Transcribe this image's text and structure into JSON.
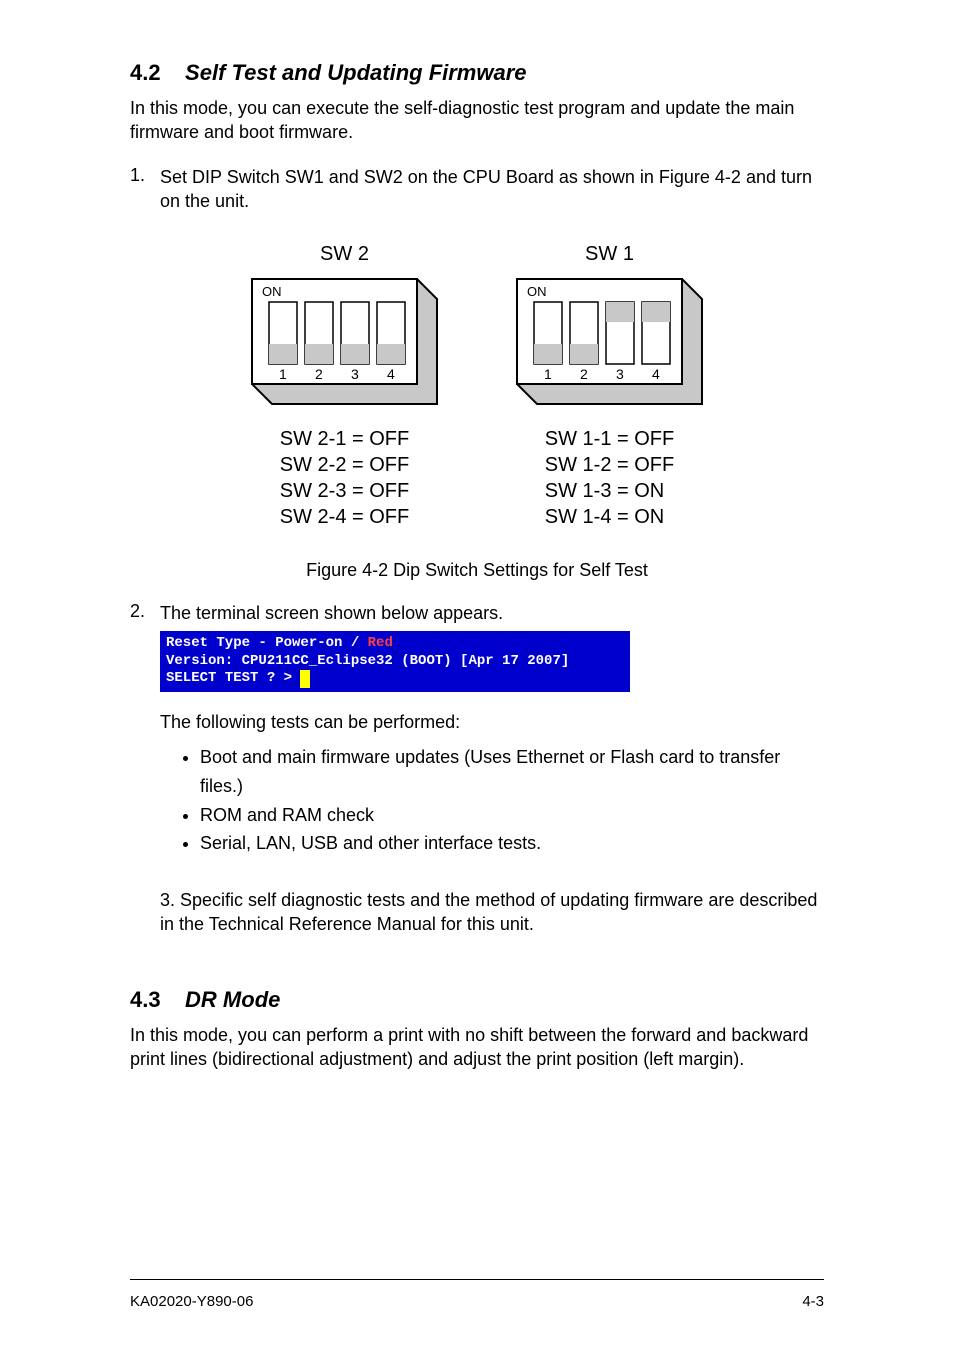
{
  "section": {
    "num": "4.2",
    "title": "Self Test and Updating Firmware"
  },
  "intro": "In this mode, you can execute the self-diagnostic test program and update the main firmware and boot firmware.",
  "steps": {
    "s1": {
      "num": "1.",
      "text": "Set DIP Switch SW1 and SW2 on the CPU Board as shown in Figure 4-2 and turn on the unit."
    },
    "s2": {
      "num": "2.",
      "text": "The terminal screen shown below appears."
    },
    "s3": {
      "num": "3.",
      "text": "Specific self diagnostic tests and the method of updating firmware are described in the Technical Reference Manual for this unit."
    }
  },
  "figure": {
    "caption": "Figure 4-2 Dip Switch Settings for Self Test"
  },
  "dip": {
    "sw2": {
      "title": "SW 2",
      "on_label": "ON",
      "positions": [
        "OFF",
        "OFF",
        "OFF",
        "OFF"
      ],
      "numbers": [
        "1",
        "2",
        "3",
        "4"
      ],
      "lines": [
        "SW 2-1 = OFF",
        "SW 2-2 = OFF",
        "SW 2-3 = OFF",
        "SW 2-4 = OFF"
      ]
    },
    "sw1": {
      "title": "SW 1",
      "on_label": "ON",
      "positions": [
        "OFF",
        "OFF",
        "ON",
        "ON"
      ],
      "numbers": [
        "1",
        "2",
        "3",
        "4"
      ],
      "lines": [
        "SW 1-1 = OFF",
        "SW 1-2 = OFF",
        "SW 1-3 = ON",
        "SW 1-4 = ON"
      ]
    }
  },
  "terminal": {
    "line1a": "Reset Type - Power-on / ",
    "line1b": "Red",
    "line2": "Version: CPU211CC_Eclipse32 (BOOT) [Apr 17 2007]",
    "line3": "SELECT TEST ? > "
  },
  "tests": {
    "label": "The following tests can be performed:",
    "items": [
      "Boot and main firmware updates (Uses Ethernet or Flash card to transfer files.)",
      "ROM and RAM check",
      "Serial, LAN, USB and other interface tests."
    ]
  },
  "next": {
    "num": "4.3",
    "title": "DR Mode",
    "text": "In this mode, you can perform a print with no shift between the forward and backward print lines (bidirectional adjustment) and adjust the print position (left margin)."
  },
  "footer": {
    "left": "KA02020-Y890-06",
    "right": "4-3"
  }
}
